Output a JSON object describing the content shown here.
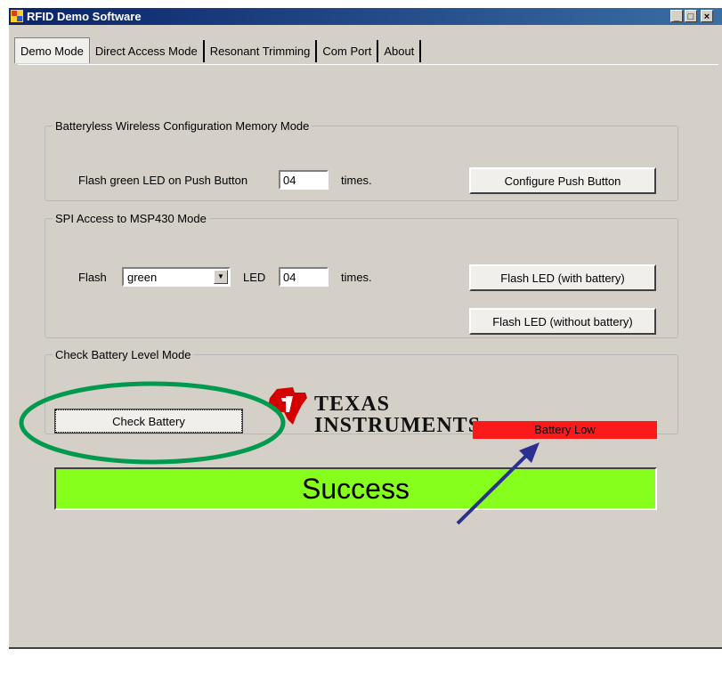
{
  "window": {
    "title": "RFID Demo Software",
    "min_label": "_",
    "max_label": "□",
    "close_label": "×"
  },
  "tabs": [
    {
      "label": "Demo Mode"
    },
    {
      "label": "Direct Access Mode"
    },
    {
      "label": "Resonant Trimming"
    },
    {
      "label": "Com Port"
    },
    {
      "label": "About"
    }
  ],
  "batteryless": {
    "legend": "Batteryless Wireless  Configuration Memory Mode",
    "prefix": "Flash green LED on Push Button",
    "count": "04",
    "suffix": "times.",
    "button": "Configure Push Button"
  },
  "spi": {
    "legend": "SPI Access to MSP430 Mode",
    "flash_label": "Flash",
    "color": "green",
    "led_label": "LED",
    "count": "04",
    "suffix": "times.",
    "button_with": "Flash LED (with battery)",
    "button_without": "Flash LED (without battery)"
  },
  "battery": {
    "legend": "Check Battery Level Mode",
    "button": "Check Battery",
    "status": "Battery Low",
    "status_color": "#fb1a1a"
  },
  "logo": {
    "line1": "TEXAS",
    "line2": "INSTRUMENTS",
    "color": "#d40000"
  },
  "result": {
    "text": "Success",
    "color": "#86ff1c"
  },
  "annotations": {
    "circle_color": "#009a4e",
    "arrow_color": "#2b2f8f"
  }
}
